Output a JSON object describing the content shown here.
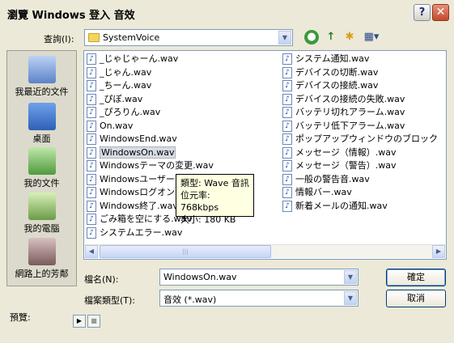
{
  "window": {
    "title": "瀏覽 Windows 登入 音效",
    "help_btn": "?",
    "close_btn": "✕"
  },
  "lookin": {
    "label": "查詢(I):",
    "value": "SystemVoice",
    "arrow": "▼"
  },
  "toolbar": {
    "back": "●",
    "up": "↑",
    "newfolder": "✱",
    "views": "▦▾"
  },
  "places": [
    {
      "label": "我最近的文件"
    },
    {
      "label": "桌面"
    },
    {
      "label": "我的文件"
    },
    {
      "label": "我的電腦"
    },
    {
      "label": "網路上的芳鄰"
    }
  ],
  "files_col1": [
    "_じゃじゃーん.wav",
    "_じゃん.wav",
    "_ちーん.wav",
    "_ぴぽ.wav",
    "_ぴろりん.wav",
    "On.wav",
    "WindowsEnd.wav",
    "WindowsOn.wav",
    "Windowsテーマの変更.wav",
    "Windowsユーザー",
    "Windowsログオン",
    "Windows終了.wav",
    "ごみ箱を空にする.wav",
    "システムエラー.wav"
  ],
  "files_col2": [
    "システム通知.wav",
    "デバイスの切断.wav",
    "デバイスの接続.wav",
    "デバイスの接続の失敗.wav",
    "バッテリ切れアラーム.wav",
    "バッテリ低下アラーム.wav",
    "ポップアップウィンドウのブロック",
    "メッセージ（情報）.wav",
    "メッセージ（警告）.wav",
    "一般の警告音.wav",
    "情報バー.wav",
    "新着メールの通知.wav"
  ],
  "file_icon": "♪",
  "scroll": {
    "left": "◀",
    "right": "▶",
    "grip": "|||"
  },
  "tooltip": {
    "line1": "類型: Wave 音訊",
    "line2": "位元率: 768kbps",
    "line3": "大小: 180 KB"
  },
  "filename": {
    "label": "檔名(N):",
    "value": "WindowsOn.wav"
  },
  "filetype": {
    "label": "檔案類型(T):",
    "value": "音效 (*.wav)"
  },
  "buttons": {
    "ok": "確定",
    "cancel": "取消"
  },
  "preview": {
    "label": "預覽:",
    "play": "▶",
    "stop": "■"
  }
}
